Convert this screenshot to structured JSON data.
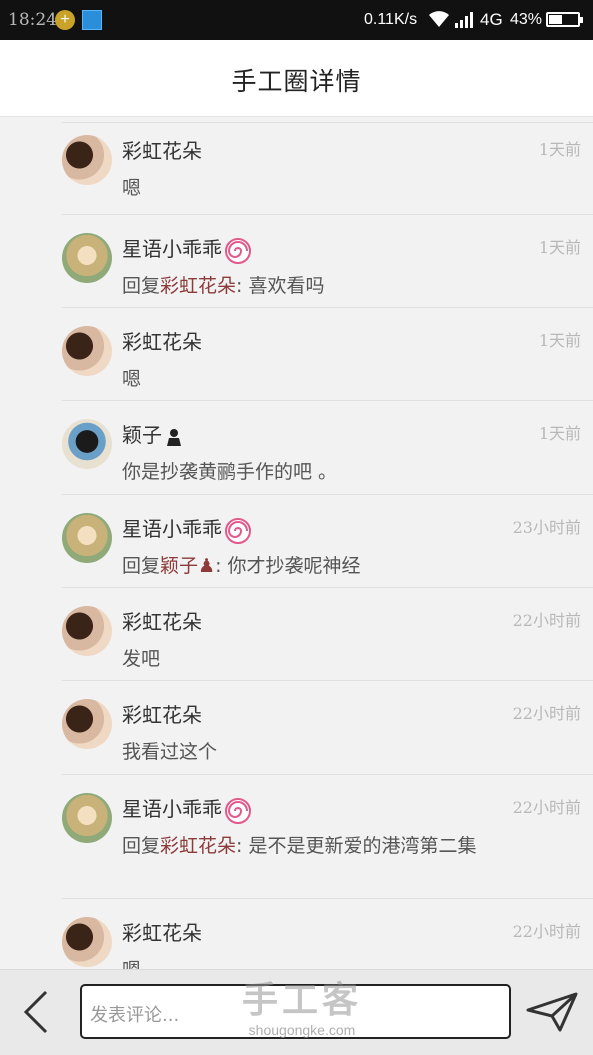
{
  "status_bar": {
    "time": "18:24",
    "network_speed": "0.11K/s",
    "network_type": "4G",
    "battery": "43%"
  },
  "header": {
    "title": "手工圈详情"
  },
  "comments": [
    {
      "name": "彩虹花朵",
      "time": "1天前",
      "content": "嗯",
      "avatar": "avatar-girl-doll",
      "badge": ""
    },
    {
      "name": "星语小乖乖",
      "time": "1天前",
      "reply_prefix": "回复",
      "reply_to": "彩虹花朵",
      "content": ": 喜欢看吗",
      "avatar": "avatar-blonde-doll",
      "badge": "lollipop-icon"
    },
    {
      "name": "彩虹花朵",
      "time": "1天前",
      "content": "嗯",
      "avatar": "avatar-girl-doll",
      "badge": ""
    },
    {
      "name": "颖子",
      "time": "1天前",
      "content": "你是抄袭黄鹂手作的吧 。",
      "avatar": "avatar-photo",
      "badge": "bust-icon"
    },
    {
      "name": "星语小乖乖",
      "time": "23小时前",
      "reply_prefix": "回复",
      "reply_to": "颖子",
      "content": ": 你才抄袭呢神经",
      "avatar": "avatar-blonde-doll",
      "badge": "lollipop-icon"
    },
    {
      "name": "彩虹花朵",
      "time": "22小时前",
      "content": "发吧",
      "avatar": "avatar-girl-doll",
      "badge": ""
    },
    {
      "name": "彩虹花朵",
      "time": "22小时前",
      "content": "我看过这个",
      "avatar": "avatar-girl-doll",
      "badge": ""
    },
    {
      "name": "星语小乖乖",
      "time": "22小时前",
      "reply_prefix": "回复",
      "reply_to": "彩虹花朵",
      "content": ": 是不是更新爱的港湾第二集",
      "avatar": "avatar-blonde-doll",
      "badge": "lollipop-icon"
    },
    {
      "name": "彩虹花朵",
      "time": "22小时前",
      "content": "嗯",
      "avatar": "avatar-girl-doll",
      "badge": ""
    }
  ],
  "bottom_bar": {
    "input_placeholder": "发表评论...",
    "back_icon": "chevron-left-icon",
    "send_icon": "paper-plane-icon",
    "watermark": "手工客",
    "watermark_url": "shougongke.com"
  }
}
